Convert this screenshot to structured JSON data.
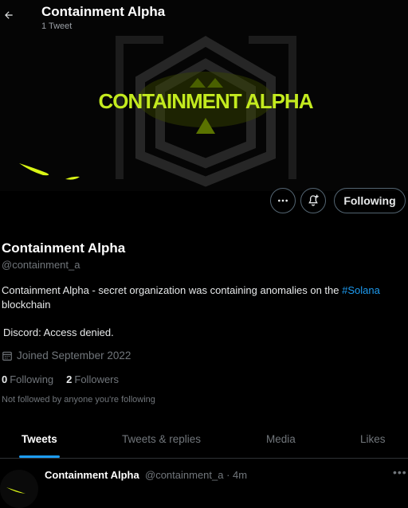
{
  "header": {
    "title": "Containment Alpha",
    "tweet_count": "1 Tweet",
    "back_icon": "arrow-left-icon"
  },
  "banner": {
    "logo_text": "CONTAINMENT ALPHA",
    "accent_color": "#b6e21a"
  },
  "actions": {
    "more_icon": "more-horizontal-icon",
    "notify_icon": "bell-plus-icon",
    "follow_label": "Following"
  },
  "profile": {
    "name": "Containment Alpha",
    "handle": "@containment_a",
    "bio_text": "Containment Alpha - secret organization was containing anomalies on the ",
    "bio_hashtag": "#Solana",
    "bio_text_end": " blockchain",
    "discord": "Discord: Access denied.",
    "calendar_icon": "calendar-icon",
    "joined": "Joined September 2022",
    "following_count": "0",
    "following_label": "Following",
    "followers_count": "2",
    "followers_label": "Followers",
    "not_followed": "Not followed by anyone you're following"
  },
  "tabs": [
    {
      "label": "Tweets",
      "active": true
    },
    {
      "label": "Tweets & replies",
      "active": false
    },
    {
      "label": "Media",
      "active": false
    },
    {
      "label": "Likes",
      "active": false
    }
  ],
  "tweet": {
    "author_name": "Containment Alpha",
    "meta": "@containment_a · 4m",
    "more_icon": "more-horizontal-icon"
  }
}
